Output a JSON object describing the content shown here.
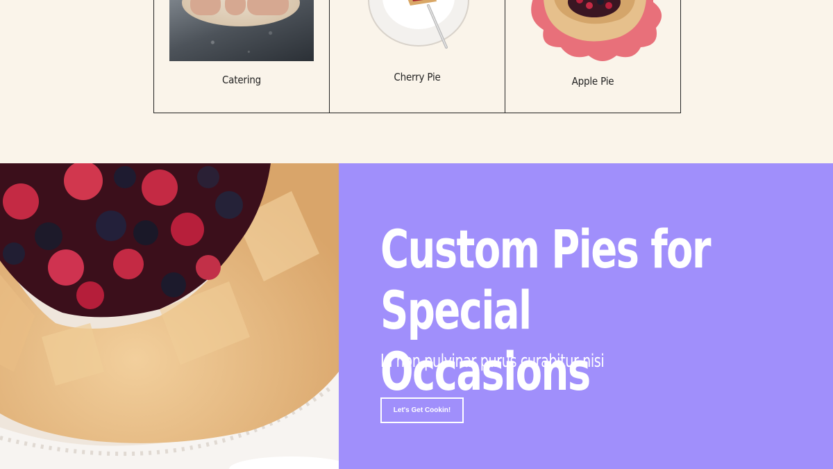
{
  "categories": [
    {
      "label": "Catering"
    },
    {
      "label": "Cherry Pie"
    },
    {
      "label": "Apple Pie"
    }
  ],
  "hero": {
    "title_line1": "Custom Pies for",
    "title_line2": "Special Occasions",
    "subtitle": "In non pulvinar purus curabitur nisi",
    "button_label": "Let's Get Cookin!"
  },
  "colors": {
    "page_background": "#faf4ea",
    "hero_panel": "#a08ffb",
    "galette_plate": "#e8707a",
    "text_dark": "#222222",
    "text_light": "#ffffff"
  }
}
